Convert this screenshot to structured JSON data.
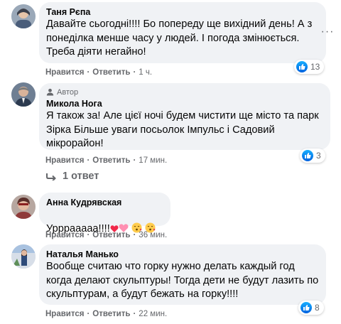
{
  "comments": [
    {
      "author": "Таня Рєпа",
      "badge": "",
      "text": "Давайте сьогодні!!!! Бо попереду ще вихідний день! А з понеділка менше часу у людей. І погода змінюється. Треба діяти негайно!",
      "like_label": "Нравится",
      "reply_label": "Ответить",
      "time": "1 ч.",
      "reaction_count": "13",
      "reaction_icon": "like-icon"
    },
    {
      "author": "Микола Нога",
      "badge": "Автор",
      "text": "Я також за! Але цієї ночі будем чистити ще місто та парк Зірка Більше уваги посьолок Імпульс і Садовий мікрорайон!",
      "like_label": "Нравится",
      "reply_label": "Ответить",
      "time": "17 мин.",
      "reaction_count": "3",
      "reaction_icon": "like-icon"
    },
    {
      "author": "Анна Кудрявская",
      "badge": "",
      "text": "Урррааааа!!!!",
      "emojis": [
        "heart-icon",
        "heart-icon",
        "kiss-face-icon",
        "kiss-face-icon"
      ],
      "like_label": "Нравится",
      "reply_label": "Ответить",
      "time": "36 мин."
    },
    {
      "author": "Наталья Манько",
      "badge": "",
      "text": "Вообще считаю что горку нужно делать каждый год когда делают скульптуры! Тогда дети не будут лазить по скульптурам, а будут бежать на горку!!!!",
      "like_label": "Нравится",
      "reply_label": "Ответить",
      "time": "22 мин.",
      "reaction_count": "8",
      "reaction_icon": "like-icon"
    }
  ],
  "replies_link": "1 ответ",
  "colors": {
    "bubble_bg": "#f0f2f5",
    "secondary_text": "#65676b",
    "like_blue": "#1877f2"
  }
}
